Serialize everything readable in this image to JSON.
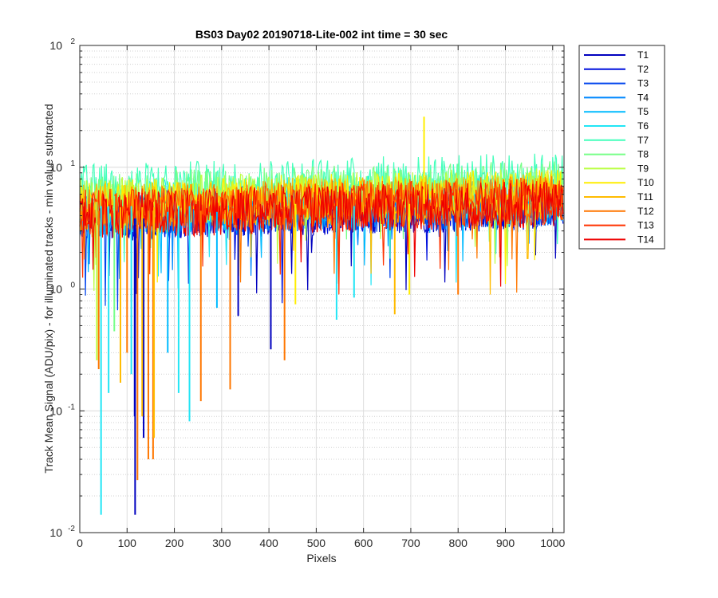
{
  "chart_data": {
    "type": "line",
    "title": "BS03 Day02 20190718-Lite-002 int time = 30 sec",
    "xlabel": "Pixels",
    "ylabel": "Track Mean Signal (ADU/pix) - for illuminated tracks - min value subtracted",
    "xlim": [
      0,
      1024
    ],
    "ylim": [
      0.01,
      100
    ],
    "yscale": "log",
    "xticks": [
      "0",
      "100",
      "200",
      "300",
      "400",
      "500",
      "600",
      "700",
      "800",
      "900",
      "1000"
    ],
    "yticks": [
      {
        "base": "10",
        "exp": "-2"
      },
      {
        "base": "10",
        "exp": "-1"
      },
      {
        "base": "10",
        "exp": "0"
      },
      {
        "base": "10",
        "exp": "1"
      },
      {
        "base": "10",
        "exp": "2"
      }
    ],
    "grid": true,
    "minor_grid": true,
    "legend_position": "outside-right",
    "series": [
      {
        "name": "T1",
        "color": "#0000bf",
        "level": 3.8
      },
      {
        "name": "T2",
        "color": "#0011dd",
        "level": 3.9
      },
      {
        "name": "T3",
        "color": "#0044ee",
        "level": 4.0
      },
      {
        "name": "T4",
        "color": "#0088ff",
        "level": 4.1
      },
      {
        "name": "T5",
        "color": "#00bbff",
        "level": 4.3
      },
      {
        "name": "T6",
        "color": "#22e5f5",
        "level": 4.8
      },
      {
        "name": "T7",
        "color": "#44ffbb",
        "level": 6.8
      },
      {
        "name": "T8",
        "color": "#77ff88",
        "level": 5.8
      },
      {
        "name": "T9",
        "color": "#bbff44",
        "level": 5.2
      },
      {
        "name": "T10",
        "color": "#ffee00",
        "level": 5.0
      },
      {
        "name": "T11",
        "color": "#ffbb00",
        "level": 4.7
      },
      {
        "name": "T12",
        "color": "#ff7700",
        "level": 4.4
      },
      {
        "name": "T13",
        "color": "#ff3300",
        "level": 4.2
      },
      {
        "name": "T14",
        "color": "#ee0000",
        "level": 4.0
      }
    ],
    "spikes": [
      {
        "series": "T1",
        "x": 117,
        "y": 0.014
      },
      {
        "series": "T1",
        "x": 116,
        "y": 0.09
      },
      {
        "series": "T1",
        "x": 135,
        "y": 0.06
      },
      {
        "series": "T1",
        "x": 404,
        "y": 0.32
      },
      {
        "series": "T6",
        "x": 45,
        "y": 0.014
      },
      {
        "series": "T6",
        "x": 61,
        "y": 0.14
      },
      {
        "series": "T6",
        "x": 209,
        "y": 0.14
      },
      {
        "series": "T6",
        "x": 232,
        "y": 0.082
      },
      {
        "series": "T6",
        "x": 109,
        "y": 0.2
      },
      {
        "series": "T5",
        "x": 186,
        "y": 0.3
      },
      {
        "series": "T12",
        "x": 122,
        "y": 0.027
      },
      {
        "series": "T12",
        "x": 145,
        "y": 0.04
      },
      {
        "series": "T12",
        "x": 155,
        "y": 0.04
      },
      {
        "series": "T12",
        "x": 256,
        "y": 0.12
      },
      {
        "series": "T12",
        "x": 318,
        "y": 0.15
      },
      {
        "series": "T12",
        "x": 433,
        "y": 0.26
      },
      {
        "series": "T12",
        "x": 40,
        "y": 0.22
      },
      {
        "series": "T12",
        "x": 100,
        "y": 0.3
      },
      {
        "series": "T11",
        "x": 86,
        "y": 0.17
      },
      {
        "series": "T11",
        "x": 157,
        "y": 0.06
      },
      {
        "series": "T11",
        "x": 132,
        "y": 0.09
      },
      {
        "series": "T11",
        "x": 666,
        "y": 0.62
      },
      {
        "series": "T9",
        "x": 36,
        "y": 0.26
      },
      {
        "series": "T8",
        "x": 73,
        "y": 0.45
      },
      {
        "series": "T10",
        "x": 728,
        "y": 26
      },
      {
        "series": "T10",
        "x": 697,
        "y": 0.9
      },
      {
        "series": "T6",
        "x": 543,
        "y": 0.56
      },
      {
        "series": "T10",
        "x": 456,
        "y": 0.75
      },
      {
        "series": "T1",
        "x": 335,
        "y": 0.6
      },
      {
        "series": "T5",
        "x": 290,
        "y": 0.7
      },
      {
        "series": "T6",
        "x": 580,
        "y": 0.85
      },
      {
        "series": "T12",
        "x": 800,
        "y": 0.9
      }
    ]
  }
}
